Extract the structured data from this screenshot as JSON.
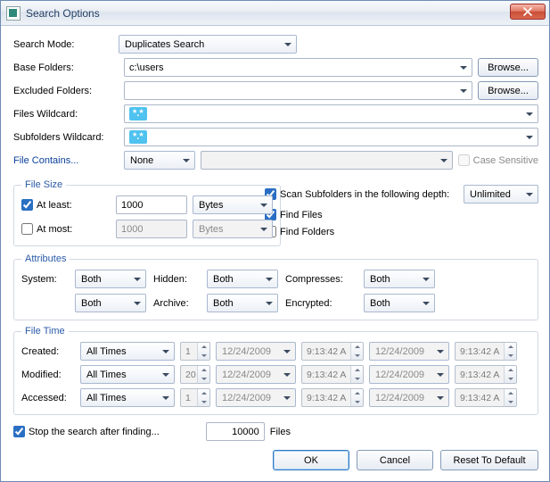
{
  "window": {
    "title": "Search Options"
  },
  "labels": {
    "search_mode": "Search Mode:",
    "base_folders": "Base Folders:",
    "excluded_folders": "Excluded Folders:",
    "files_wildcard": "Files Wildcard:",
    "subfolders_wildcard": "Subfolders Wildcard:",
    "file_contains": "File Contains...",
    "case_sensitive": "Case Sensitive",
    "browse": "Browse...",
    "file_size": "File Size",
    "at_least": "At least:",
    "at_most": "At most:",
    "scan_subfolders": "Scan Subfolders in the following depth:",
    "find_files": "Find Files",
    "find_folders": "Find Folders",
    "attributes": "Attributes",
    "system": "System:",
    "hidden": "Hidden:",
    "compresses": "Compresses:",
    "archive": "Archive:",
    "encrypted": "Encrypted:",
    "file_time": "File Time",
    "created": "Created:",
    "modified": "Modified:",
    "accessed": "Accessed:",
    "stop_after": "Stop the search after finding...",
    "files_suffix": "Files",
    "ok": "OK",
    "cancel": "Cancel",
    "reset": "Reset To Default"
  },
  "values": {
    "search_mode": "Duplicates Search",
    "base_folders": "c:\\users",
    "excluded_folders": "",
    "files_wildcard_token": "*.*",
    "subfolders_wildcard_token": "*.*",
    "file_contains_mode": "None",
    "file_contains_text": "",
    "case_sensitive_checked": false,
    "at_least_checked": true,
    "at_least_value": "1000",
    "at_least_unit": "Bytes",
    "at_most_checked": false,
    "at_most_value": "1000",
    "at_most_unit": "Bytes",
    "scan_subfolders_checked": true,
    "depth": "Unlimited",
    "find_files_checked": true,
    "find_folders_checked": false,
    "attr_system": "Both",
    "attr_readonly": "Both",
    "attr_hidden": "Both",
    "attr_archive": "Both",
    "attr_compresses": "Both",
    "attr_encrypted": "Both",
    "time_mode": "All Times",
    "created_n": "1",
    "modified_n": "20",
    "accessed_n": "1",
    "date_sample": "12/24/2009",
    "time_sample": "9:13:42 A",
    "stop_after_checked": true,
    "stop_after_value": "10000"
  }
}
